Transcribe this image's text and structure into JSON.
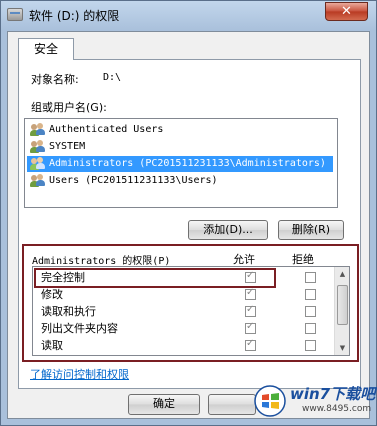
{
  "window": {
    "title": "软件 (D:) 的权限",
    "close_glyph": "✕"
  },
  "tabs": [
    {
      "label": "安全"
    }
  ],
  "object": {
    "label": "对象名称:",
    "value": "D:\\"
  },
  "group": {
    "label": "组或用户名(G):",
    "users": [
      {
        "name": "Authenticated Users",
        "icon": "users-icon"
      },
      {
        "name": "SYSTEM",
        "icon": "users-icon"
      },
      {
        "name": "Administrators (PC201511231133\\Administrators)",
        "icon": "users-icon",
        "selected": true
      },
      {
        "name": "Users (PC201511231133\\Users)",
        "icon": "users-icon"
      }
    ]
  },
  "buttons": {
    "add": "添加(D)...",
    "remove": "删除(R)",
    "ok": "确定"
  },
  "permissions": {
    "label": "Administrators 的权限(P)",
    "allow_header": "允许",
    "deny_header": "拒绝",
    "rows": [
      {
        "name": "完全控制",
        "allow": true,
        "deny": false
      },
      {
        "name": "修改",
        "allow": true,
        "deny": false
      },
      {
        "name": "读取和执行",
        "allow": true,
        "deny": false
      },
      {
        "name": "列出文件夹内容",
        "allow": true,
        "deny": false
      },
      {
        "name": "读取",
        "allow": true,
        "deny": false
      }
    ]
  },
  "link": "了解访问控制和权限",
  "watermark": {
    "brand": "win7下载吧",
    "url": "www.8495.com"
  },
  "colors": {
    "selection": "#3399ff",
    "highlight_box": "#7a1e23",
    "link": "#0066cc"
  }
}
